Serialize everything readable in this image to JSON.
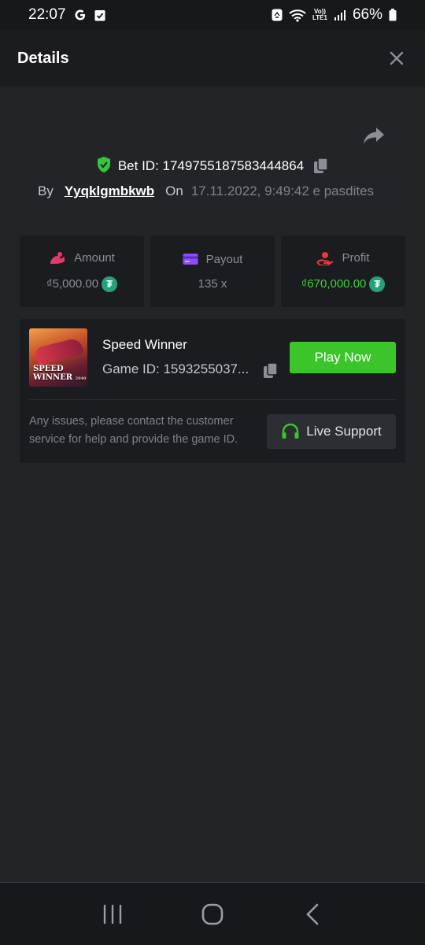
{
  "status_bar": {
    "time": "22:07",
    "left_icons": [
      "google-g-icon",
      "check-box-icon"
    ],
    "right_icons": [
      "recycle-icon",
      "wifi-icon",
      "volte-icon",
      "signal-icon",
      "battery-icon"
    ],
    "volte_line1": "Vo))",
    "volte_line2": "LTE1",
    "battery_percent": "66%"
  },
  "header": {
    "title": "Details",
    "close_icon": "close-icon"
  },
  "bet": {
    "label": "Bet ID: 1749755187583444864",
    "by_label": "By",
    "user": "Yyqklgmbkwb",
    "on_label": "On",
    "date": "17.11.2022, 9:49:42 e pasdites"
  },
  "stats": [
    {
      "label": "Amount",
      "value": "₫5,000.00",
      "icon": "amount-icon",
      "color": "#e8386a",
      "coin": true
    },
    {
      "label": "Payout",
      "value": "135 x",
      "icon": "card-icon",
      "color": "#8b4cff",
      "coin": false
    },
    {
      "label": "Profit",
      "value": "₫670,000.00",
      "icon": "profit-icon",
      "color": "#e33a3a",
      "coin": true
    }
  ],
  "coin_symbol": "₮",
  "game": {
    "name": "Speed Winner",
    "id": "Game ID: 1593255037...",
    "thumb_line1": "SPEED",
    "thumb_line2": "WINNER",
    "thumb_tag": "2040",
    "play_label": "Play Now",
    "issue_text": "Any issues, please contact the customer service for help and provide the game ID.",
    "support_label": "Live Support"
  },
  "colors": {
    "accent_green": "#3cc52b",
    "profit_green": "#3dd13a",
    "background": "#232428",
    "card": "#1b1c20"
  }
}
